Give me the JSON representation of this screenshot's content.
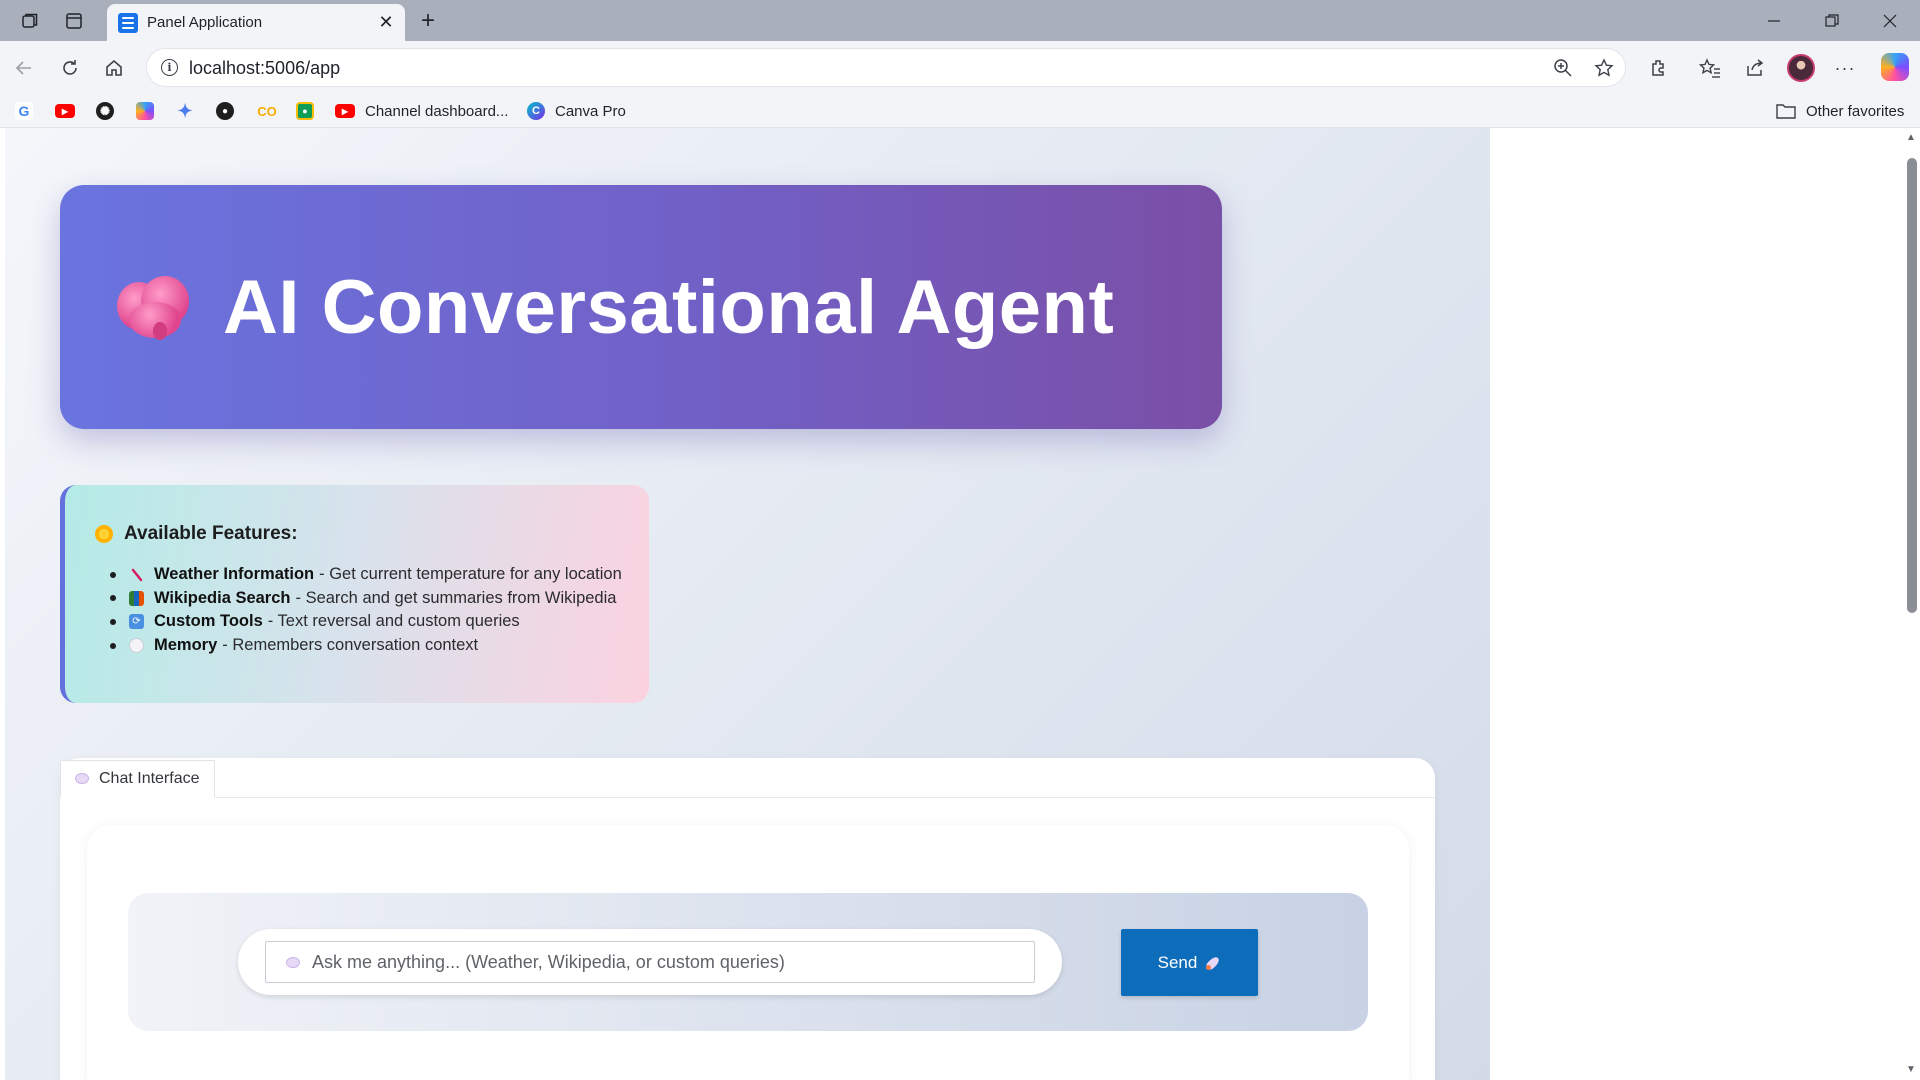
{
  "browser": {
    "tab_title": "Panel Application",
    "url": "localhost:5006/app",
    "bookmarks": [
      {
        "label": "Channel dashboard...",
        "icon": "youtube-icon"
      },
      {
        "label": "Canva Pro",
        "icon": "canva-icon"
      }
    ],
    "other_favorites": "Other favorites"
  },
  "header": {
    "icon": "brain-icon",
    "title": "AI Conversational Agent"
  },
  "features": {
    "heading": "Available Features:",
    "items": [
      {
        "icon": "thermometer-icon",
        "name": "Weather Information",
        "desc": "- Get current temperature for any location"
      },
      {
        "icon": "books-icon",
        "name": "Wikipedia Search",
        "desc": "- Search and get summaries from Wikipedia"
      },
      {
        "icon": "refresh-icon",
        "name": "Custom Tools",
        "desc": "- Text reversal and custom queries"
      },
      {
        "icon": "thought-bubble-icon",
        "name": "Memory",
        "desc": "- Remembers conversation context"
      }
    ]
  },
  "chat": {
    "tab_label": "Chat Interface",
    "input_placeholder": "Ask me anything... (Weather, Wikipedia, or custom queries)",
    "send_label": "Send"
  },
  "colors": {
    "header_gradient_start": "#6a74df",
    "header_gradient_end": "#7a4fa6",
    "send_button": "#0d6dbb",
    "features_border": "#6470dc"
  }
}
